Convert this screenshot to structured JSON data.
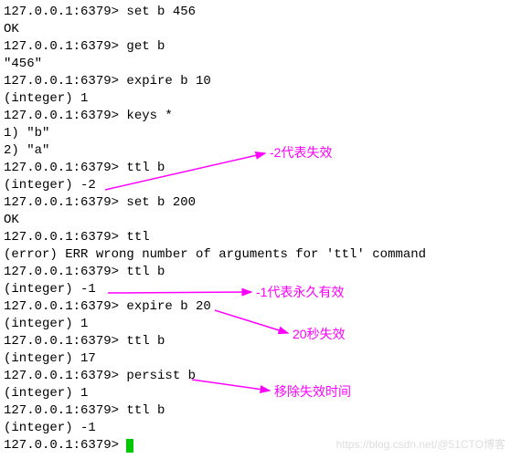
{
  "prompt": "127.0.0.1:6379>",
  "lines": [
    {
      "type": "cmd",
      "text": "set b 456"
    },
    {
      "type": "out",
      "text": "OK"
    },
    {
      "type": "cmd",
      "text": "get b"
    },
    {
      "type": "out",
      "text": "\"456\""
    },
    {
      "type": "cmd",
      "text": "expire b 10"
    },
    {
      "type": "out",
      "text": "(integer) 1"
    },
    {
      "type": "cmd",
      "text": "keys *"
    },
    {
      "type": "out",
      "text": "1) \"b\""
    },
    {
      "type": "out",
      "text": "2) \"a\""
    },
    {
      "type": "cmd",
      "text": "ttl b"
    },
    {
      "type": "out",
      "text": "(integer) -2"
    },
    {
      "type": "cmd",
      "text": "set b 200"
    },
    {
      "type": "out",
      "text": "OK"
    },
    {
      "type": "cmd",
      "text": "ttl"
    },
    {
      "type": "out",
      "text": "(error) ERR wrong number of arguments for 'ttl' command"
    },
    {
      "type": "cmd",
      "text": "ttl b"
    },
    {
      "type": "out",
      "text": "(integer) -1"
    },
    {
      "type": "cmd",
      "text": "expire b 20"
    },
    {
      "type": "out",
      "text": "(integer) 1"
    },
    {
      "type": "cmd",
      "text": "ttl b"
    },
    {
      "type": "out",
      "text": "(integer) 17"
    },
    {
      "type": "cmd",
      "text": "persist b"
    },
    {
      "type": "out",
      "text": "(integer) 1"
    },
    {
      "type": "cmd",
      "text": "ttl b"
    },
    {
      "type": "out",
      "text": "(integer) -1"
    },
    {
      "type": "cursor",
      "text": ""
    }
  ],
  "annotations": {
    "a1": "-2代表失效",
    "a2": "-1代表永久有效",
    "a3": "20秒失效",
    "a4": "移除失效时间"
  },
  "watermark_left": "https://blog.csdn.net/",
  "watermark_right": "@51CTO博客"
}
